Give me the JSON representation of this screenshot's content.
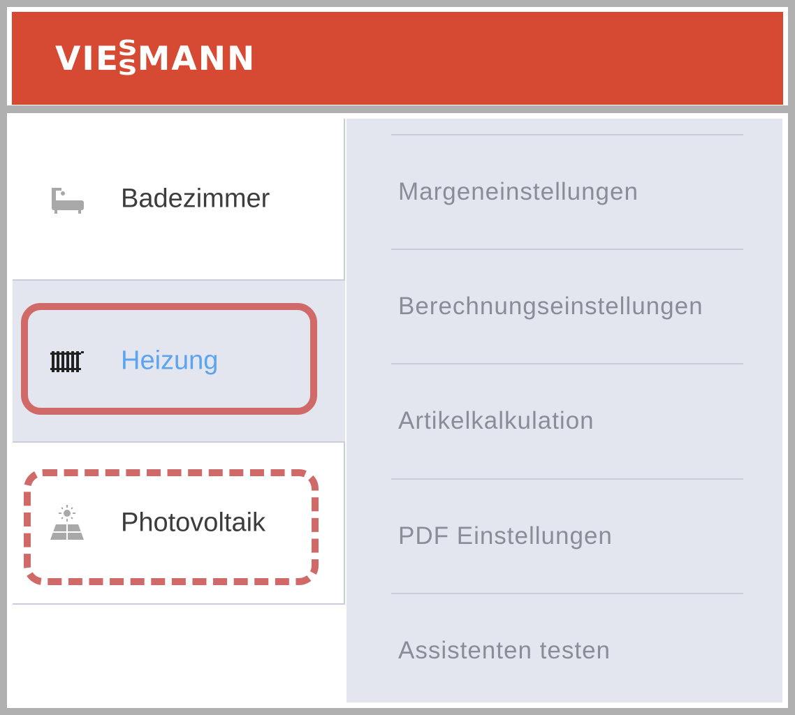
{
  "brand": {
    "name_left": "VIE",
    "name_ss": [
      "S",
      "S"
    ],
    "name_right": "MANN",
    "color": "#d64a33"
  },
  "sidebar": {
    "items": [
      {
        "label": "Badezimmer",
        "icon": "bathtub-icon",
        "active": false
      },
      {
        "label": "Heizung",
        "icon": "radiator-icon",
        "active": true
      },
      {
        "label": "Photovoltaik",
        "icon": "solar-panel-icon",
        "active": false
      }
    ]
  },
  "menu": {
    "items": [
      {
        "label": "Margeneinstellungen"
      },
      {
        "label": "Berechnungseinstellungen"
      },
      {
        "label": "Artikelkalkulation"
      },
      {
        "label": "PDF Einstellungen"
      },
      {
        "label": "Assistenten testen"
      }
    ]
  },
  "annotations": {
    "solid_highlight": "Heizung",
    "dashed_highlight": "Photovoltaik",
    "color": "#d06a68"
  }
}
